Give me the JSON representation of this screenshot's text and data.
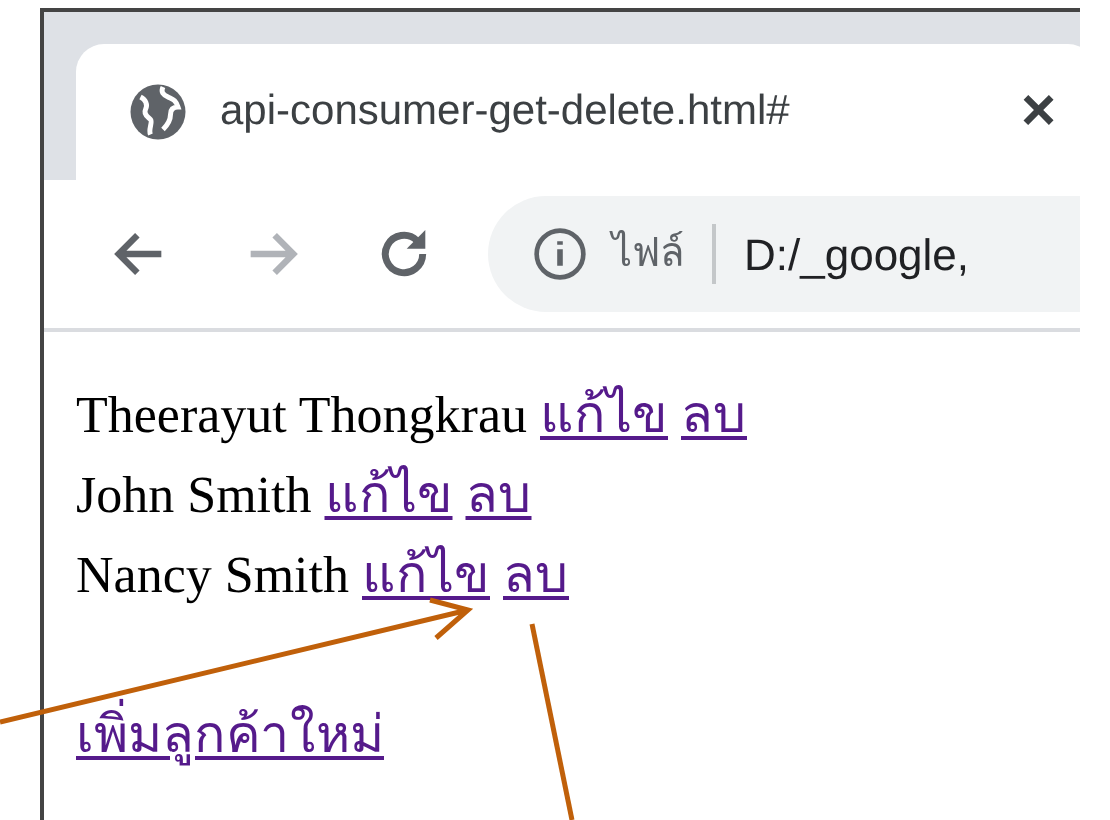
{
  "tab": {
    "title": "api-consumer-get-delete.html#",
    "close": "×"
  },
  "address_bar": {
    "scheme_label": "ไฟล์",
    "url": "D:/_google,"
  },
  "customers": [
    {
      "name": "Theerayut Thongkrau",
      "edit_link": "แก้ไข",
      "delete_link": "ลบ"
    },
    {
      "name": "John Smith",
      "edit_link": "แก้ไข",
      "delete_link": "ลบ"
    },
    {
      "name": "Nancy Smith",
      "edit_link": "แก้ไข",
      "delete_link": "ลบ"
    }
  ],
  "add_link": "เพิ่มลูกค้าใหม่"
}
